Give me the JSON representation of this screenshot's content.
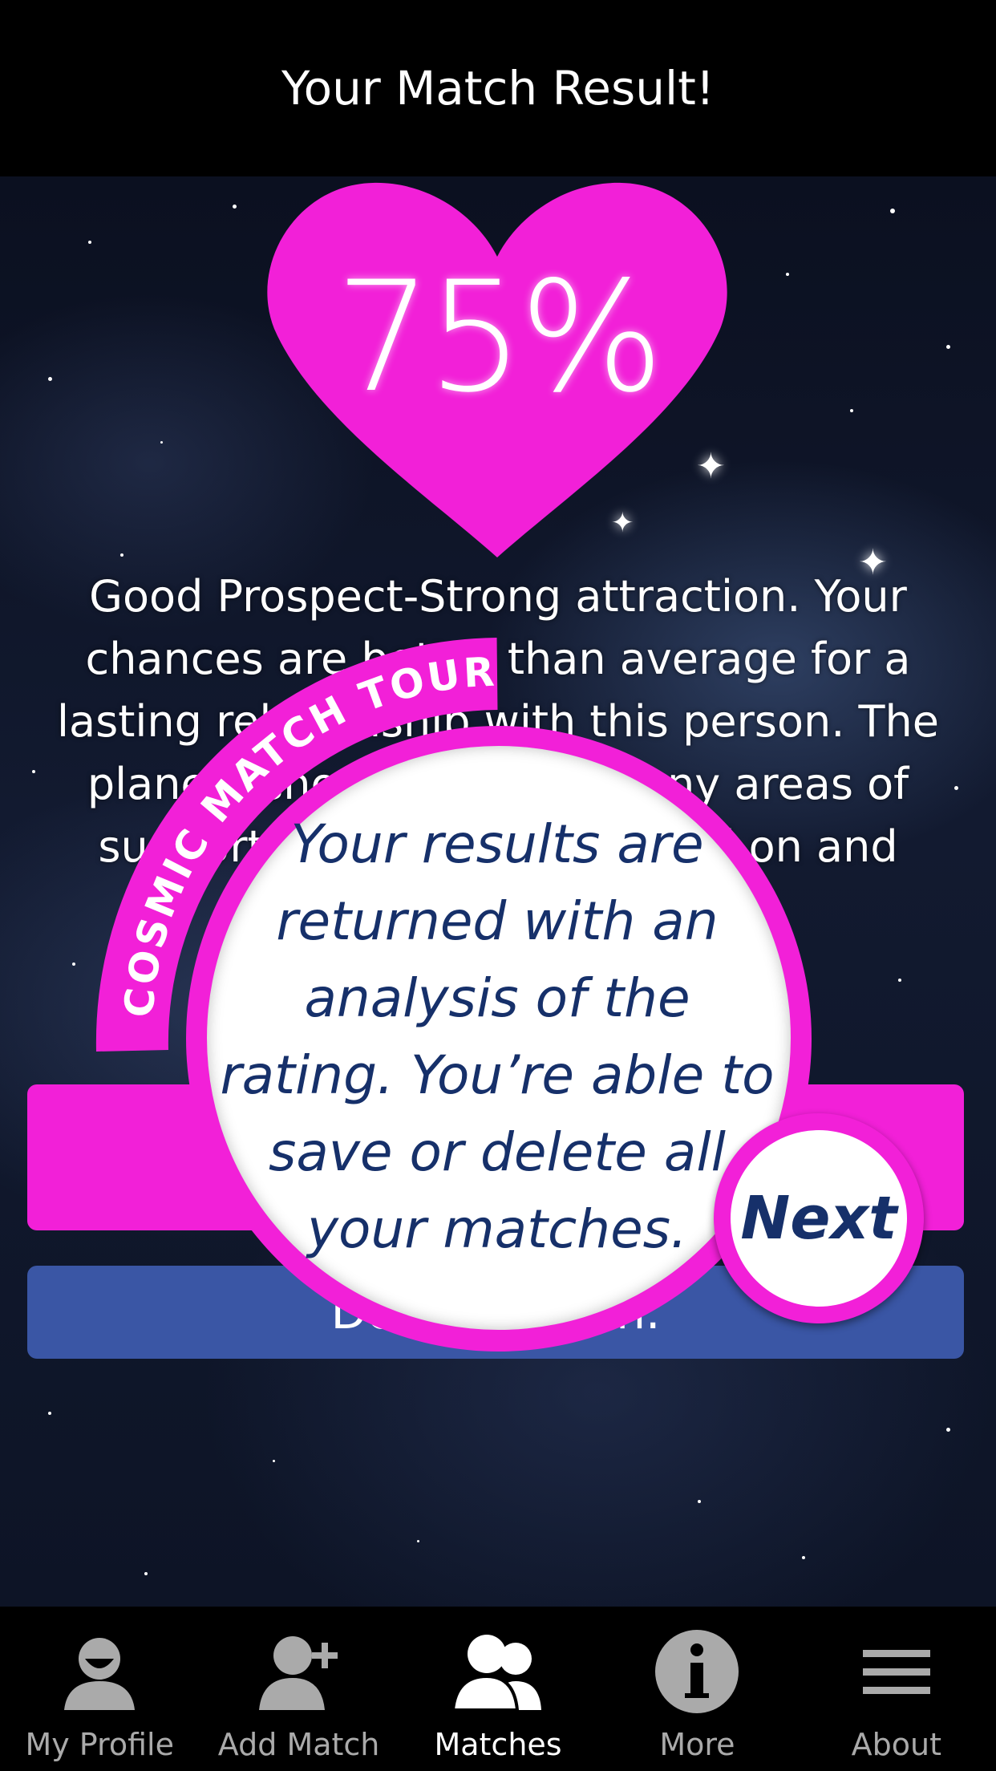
{
  "header": {
    "title": "Your Match Result!"
  },
  "result": {
    "percentage": "75%",
    "description": "Good Prospect-Strong attraction. Your chances are better than average for a lasting relationship with this person. The planets show there are many areas of support which can be worked on and improved!"
  },
  "buttons": {
    "save_label": "",
    "delete_label": "Delete match."
  },
  "tour": {
    "banner": "COSMIC MATCH TOUR",
    "message": "Your results are returned with an analysis of the rating. You’re able to save or delete all your matches.",
    "next_label": "Next"
  },
  "tabs": [
    {
      "label": "My Profile",
      "icon": "person-icon"
    },
    {
      "label": "Add Match",
      "icon": "add-person-icon"
    },
    {
      "label": "Matches",
      "icon": "people-icon"
    },
    {
      "label": "More",
      "icon": "info-icon"
    },
    {
      "label": "About",
      "icon": "menu-icon"
    }
  ],
  "colors": {
    "accent": "#f220d8",
    "navy": "#16306a",
    "delete": "#3a56a5"
  }
}
